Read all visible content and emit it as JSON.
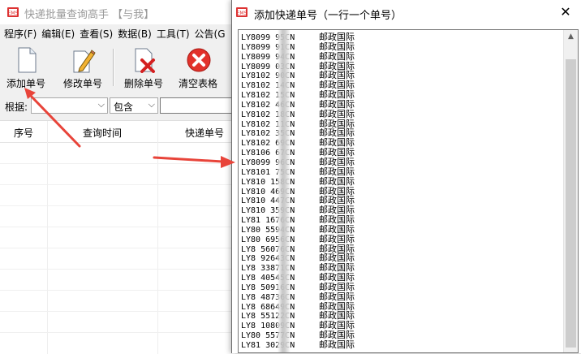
{
  "main_window": {
    "title": "快递批量查询高手 【与我】",
    "menu": [
      "程序(F)",
      "编辑(E)",
      "查看(S)",
      "数据(B)",
      "工具(T)",
      "公告(G"
    ],
    "toolbar": {
      "add_label": "添加单号",
      "edit_label": "修改单号",
      "delete_label": "删除单号",
      "clear_label": "清空表格"
    },
    "filter": {
      "label": "根据:",
      "field_value": "",
      "mode_value": "包含",
      "search_value": ""
    },
    "table": {
      "columns": [
        "序号",
        "查询时间",
        "快递单号"
      ]
    }
  },
  "dialog": {
    "title": "添加快递单号（一行一个单号）",
    "close_label": "✕",
    "tracking_lines": [
      {
        "number": "LY8099   95CN",
        "company": "邮政国际"
      },
      {
        "number": "LY8099   91CN",
        "company": "邮政国际"
      },
      {
        "number": "LY8099   94CN",
        "company": "邮政国际"
      },
      {
        "number": "LY8099   03CN",
        "company": "邮政国际"
      },
      {
        "number": "LY8102   90CN",
        "company": "邮政国际"
      },
      {
        "number": "LY8102   14CN",
        "company": "邮政国际"
      },
      {
        "number": "LY8102   15CN",
        "company": "邮政国际"
      },
      {
        "number": "LY8102   46CN",
        "company": "邮政国际"
      },
      {
        "number": "LY8102   18CN",
        "company": "邮政国际"
      },
      {
        "number": "LY8102   11CN",
        "company": "邮政国际"
      },
      {
        "number": "LY8102   35CN",
        "company": "邮政国际"
      },
      {
        "number": "LY8102   69CN",
        "company": "邮政国际"
      },
      {
        "number": "LY8106   67CN",
        "company": "邮政国际"
      },
      {
        "number": "LY8099   96CN",
        "company": "邮政国际"
      },
      {
        "number": "LY8101   75CN",
        "company": "邮政国际"
      },
      {
        "number": "LY810   158CN",
        "company": "邮政国际"
      },
      {
        "number": "LY810   469CN",
        "company": "邮政国际"
      },
      {
        "number": "LY810   447CN",
        "company": "邮政国际"
      },
      {
        "number": "LY810   359CN",
        "company": "邮政国际"
      },
      {
        "number": "LY81   1676CN",
        "company": "邮政国际"
      },
      {
        "number": "LY80   5594CN",
        "company": "邮政国际"
      },
      {
        "number": "LY80   6956CN",
        "company": "邮政国际"
      },
      {
        "number": "LY8   56076CN",
        "company": "邮政国际"
      },
      {
        "number": "LY8   92643CN",
        "company": "邮政国际"
      },
      {
        "number": "LY8   33871CN",
        "company": "邮政国际"
      },
      {
        "number": "LY8   40545CN",
        "company": "邮政国际"
      },
      {
        "number": "LY8   50916CN",
        "company": "邮政国际"
      },
      {
        "number": "LY8   48736CN",
        "company": "邮政国际"
      },
      {
        "number": "LY8   68649CN",
        "company": "邮政国际"
      },
      {
        "number": "LY8   55122CN",
        "company": "邮政国际"
      },
      {
        "number": "LY8   10809CN",
        "company": "邮政国际"
      },
      {
        "number": "LY80   5577CN",
        "company": "邮政国际"
      },
      {
        "number": "LY81   3029CN",
        "company": "邮政国际"
      }
    ]
  },
  "colors": {
    "arrow": "#e8443a",
    "window_bg": "#f0f0f0",
    "dialog_bg": "#ffffff",
    "scroll_thumb": "#cdcdcd"
  }
}
